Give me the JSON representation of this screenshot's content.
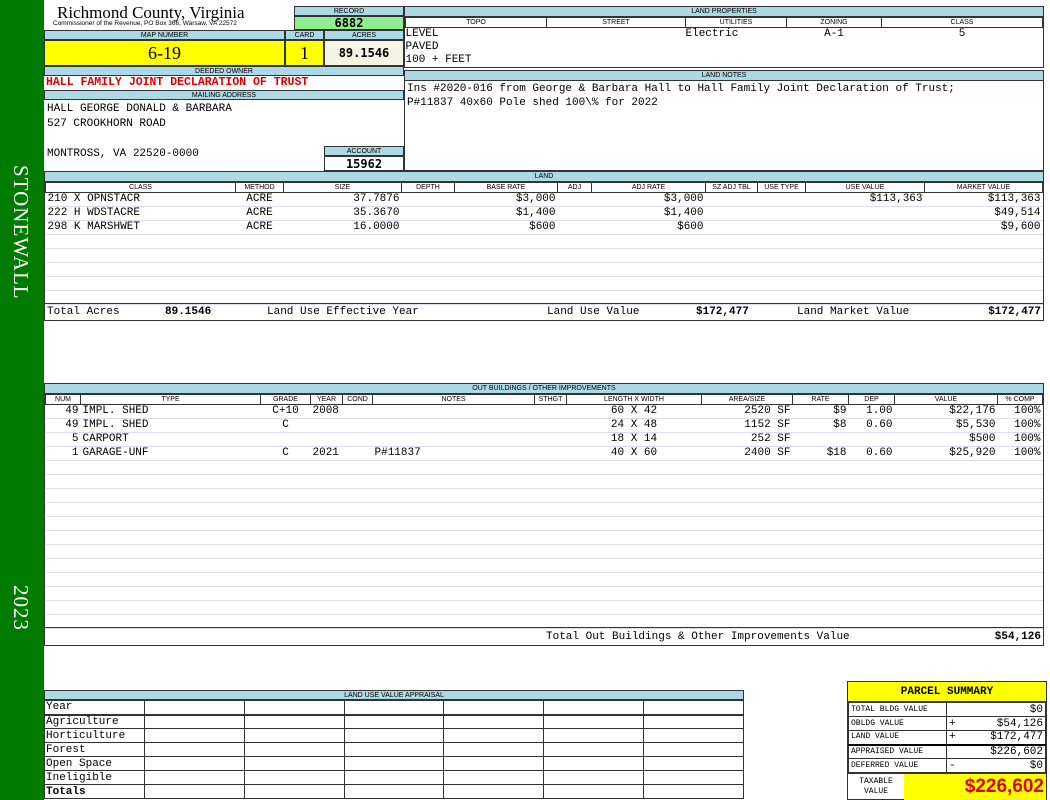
{
  "sidebar": {
    "district": "STONEWALL",
    "year": "2023"
  },
  "header": {
    "title": "Richmond County, Virginia",
    "subtitle": "Commissioner of the Revenue, PO Box 366, Warsaw, VA 22572",
    "record_label": "RECORD",
    "record": "6882",
    "map_label": "MAP NUMBER",
    "map_number": "6-19",
    "card_label": "CARD",
    "card": "1",
    "acres_label": "ACRES",
    "acres": "89.1546"
  },
  "owner": {
    "label": "DEEDED OWNER",
    "name": "HALL FAMILY JOINT DECLARATION OF TRUST",
    "address_label": "MAILING ADDRESS",
    "address": [
      "HALL GEORGE DONALD & BARBARA",
      "527 CROOKHORN ROAD",
      "",
      "MONTROSS, VA 22520-0000"
    ],
    "account_label": "ACCOUNT",
    "account": "15962"
  },
  "land_properties": {
    "label": "LAND PROPERTIES",
    "columns": [
      "TOPO",
      "STREET",
      "UTILITIES",
      "ZONING",
      "CLASS"
    ],
    "topo": [
      "LEVEL",
      "PAVED",
      "100 + FEET"
    ],
    "utilities": "Electric",
    "zoning": "A-1",
    "class": "5"
  },
  "land_notes": {
    "label": "LAND NOTES",
    "text": "Ins #2020-016 from George & Barbara Hall to Hall Family Joint Declaration of Trust; P#11837 40x60 Pole shed 100\\% for 2022"
  },
  "land": {
    "label": "LAND",
    "columns": [
      "CLASS",
      "METHOD",
      "SIZE",
      "DEPTH",
      "BASE RATE",
      "ADJ",
      "ADJ RATE",
      "SZ ADJ TBL",
      "USE TYPE",
      "USE VALUE",
      "MARKET VALUE"
    ],
    "rows": [
      [
        "210 X OPNSTACR",
        "ACRE",
        "37.7876",
        "",
        "$3,000",
        "",
        "$3,000",
        "",
        "",
        "$113,363",
        "$113,363"
      ],
      [
        "222 H WDSTACRE",
        "ACRE",
        "35.3670",
        "",
        "$1,400",
        "",
        "$1,400",
        "",
        "",
        "",
        "$49,514"
      ],
      [
        "298 K MARSHWET",
        "ACRE",
        "16.0000",
        "",
        "$600",
        "",
        "$600",
        "",
        "",
        "",
        "$9,600"
      ]
    ],
    "totals": {
      "acres_label": "Total Acres",
      "acres": "89.1546",
      "effective_year_label": "Land Use Effective Year",
      "use_value_label": "Land Use Value",
      "use_value": "$172,477",
      "market_value_label": "Land Market Value",
      "market_value": "$172,477"
    }
  },
  "outbuildings": {
    "label": "OUT BUILDINGS / OTHER IMPROVEMENTS",
    "columns": [
      "NUM",
      "TYPE",
      "GRADE",
      "YEAR",
      "COND",
      "NOTES",
      "STHGT",
      "LENGTH X WIDTH",
      "AREA/SIZE",
      "RATE",
      "DEP",
      "VALUE",
      "% COMP"
    ],
    "rows": [
      [
        "49",
        "IMPL. SHED",
        "C+10",
        "2008",
        "",
        "",
        "",
        "60 X 42",
        "2520 SF",
        "$9",
        "1.00",
        "$22,176",
        "100%"
      ],
      [
        "49",
        "IMPL. SHED",
        "C",
        "",
        "",
        "",
        "",
        "24 X 48",
        "1152 SF",
        "$8",
        "0.60",
        "$5,530",
        "100%"
      ],
      [
        "5",
        "CARPORT",
        "",
        "",
        "",
        "",
        "",
        "18 X 14",
        "252 SF",
        "",
        "",
        "$500",
        "100%"
      ],
      [
        "1",
        "GARAGE-UNF",
        "C",
        "2021",
        "",
        "P#11837",
        "",
        "40 X 60",
        "2400 SF",
        "$18",
        "0.60",
        "$25,920",
        "100%"
      ]
    ],
    "total_label": "Total Out Buildings & Other Improvements Value",
    "total": "$54,126"
  },
  "land_use": {
    "label": "LAND USE VALUE APPRAISAL",
    "year_label": "Year",
    "rows": [
      "Agriculture",
      "Horticulture",
      "Forest",
      "Open Space",
      "Ineligible"
    ],
    "totals_label": "Totals"
  },
  "summary": {
    "title": "PARCEL SUMMARY",
    "rows": [
      {
        "label": "TOTAL BLDG VALUE",
        "sign": "",
        "value": "$0"
      },
      {
        "label": "OBLDG VALUE",
        "sign": "+",
        "value": "$54,126"
      },
      {
        "label": "LAND VALUE",
        "sign": "+",
        "value": "$172,477"
      },
      {
        "label": "APPRAISED VALUE",
        "sign": "",
        "value": "$226,602"
      },
      {
        "label": "DEFERRED VALUE",
        "sign": "-",
        "value": "$0"
      }
    ],
    "taxable_label": "TAXABLE VALUE",
    "taxable": "$226,602"
  },
  "colors": {
    "green": "#007a00",
    "header_blue": "#add8e6",
    "yellow": "#ffff00",
    "red": "#e00000"
  }
}
